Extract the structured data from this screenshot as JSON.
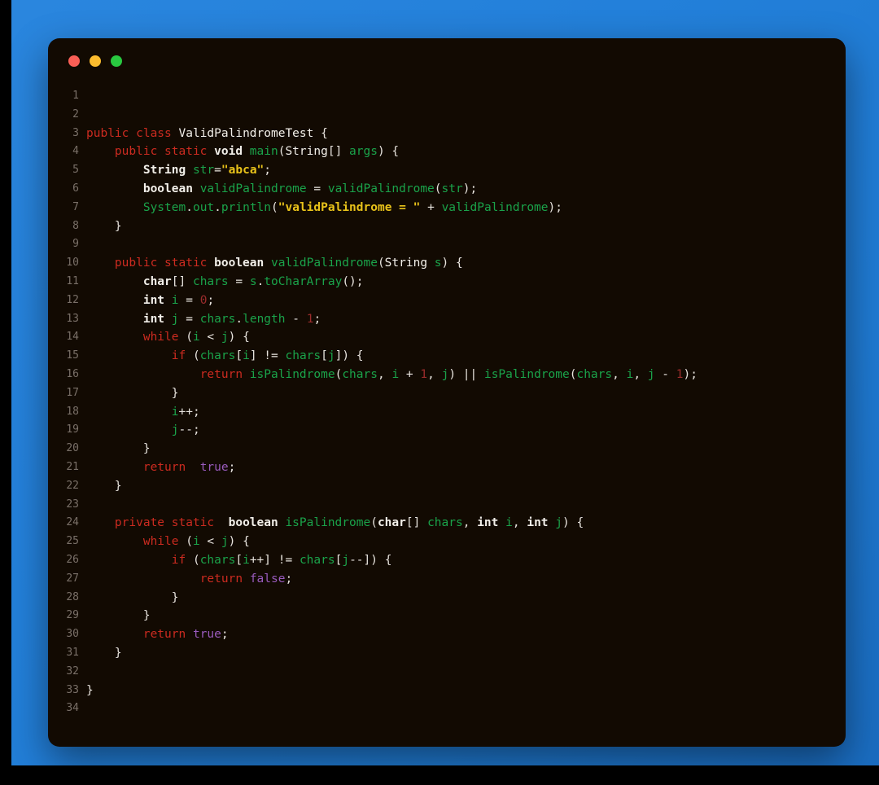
{
  "window": {
    "background_color": "#2380da",
    "card_background": "#120a02",
    "traffic_lights": [
      {
        "name": "close",
        "color": "#fa5f56"
      },
      {
        "name": "minimize",
        "color": "#fcbc2e"
      },
      {
        "name": "maximize",
        "color": "#29c940"
      }
    ]
  },
  "editor": {
    "language": "java",
    "file_class": "ValidPalindromeTest",
    "total_lines": 34,
    "theme": {
      "keyword": "#cc2b20",
      "type": "#f2efe9",
      "identifier": "#1aa34a",
      "string": "#e8c21a",
      "number": "#9b2c2c",
      "literal": "#9a5bbd",
      "punctuation": "#e8e4de",
      "line_number": "#7a7068"
    },
    "lines": [
      {
        "n": "1",
        "tokens": []
      },
      {
        "n": "2",
        "tokens": []
      },
      {
        "n": "3",
        "tokens": [
          {
            "t": "public ",
            "c": "kw"
          },
          {
            "t": "class ",
            "c": "kw"
          },
          {
            "t": "ValidPalindromeTest",
            "c": "cls"
          },
          {
            "t": " {",
            "c": "pun"
          }
        ]
      },
      {
        "n": "4",
        "tokens": [
          {
            "t": "    ",
            "c": "pun"
          },
          {
            "t": "public ",
            "c": "kw"
          },
          {
            "t": "static ",
            "c": "kw"
          },
          {
            "t": "void",
            "c": "typ"
          },
          {
            "t": " ",
            "c": "pun"
          },
          {
            "t": "main",
            "c": "var"
          },
          {
            "t": "(",
            "c": "pun"
          },
          {
            "t": "String",
            "c": "cls"
          },
          {
            "t": "[] ",
            "c": "pun"
          },
          {
            "t": "args",
            "c": "var"
          },
          {
            "t": ") {",
            "c": "pun"
          }
        ]
      },
      {
        "n": "5",
        "tokens": [
          {
            "t": "        ",
            "c": "pun"
          },
          {
            "t": "String",
            "c": "typ"
          },
          {
            "t": " ",
            "c": "pun"
          },
          {
            "t": "str",
            "c": "var"
          },
          {
            "t": "=",
            "c": "pun"
          },
          {
            "t": "\"abca\"",
            "c": "str"
          },
          {
            "t": ";",
            "c": "pun"
          }
        ]
      },
      {
        "n": "6",
        "tokens": [
          {
            "t": "        ",
            "c": "pun"
          },
          {
            "t": "boolean",
            "c": "typ"
          },
          {
            "t": " ",
            "c": "pun"
          },
          {
            "t": "validPalindrome",
            "c": "var"
          },
          {
            "t": " = ",
            "c": "pun"
          },
          {
            "t": "validPalindrome",
            "c": "var"
          },
          {
            "t": "(",
            "c": "pun"
          },
          {
            "t": "str",
            "c": "var"
          },
          {
            "t": ");",
            "c": "pun"
          }
        ]
      },
      {
        "n": "7",
        "tokens": [
          {
            "t": "        ",
            "c": "pun"
          },
          {
            "t": "System",
            "c": "var"
          },
          {
            "t": ".",
            "c": "pun"
          },
          {
            "t": "out",
            "c": "var"
          },
          {
            "t": ".",
            "c": "pun"
          },
          {
            "t": "println",
            "c": "var"
          },
          {
            "t": "(",
            "c": "pun"
          },
          {
            "t": "\"validPalindrome = \"",
            "c": "str"
          },
          {
            "t": " + ",
            "c": "pun"
          },
          {
            "t": "validPalindrome",
            "c": "var"
          },
          {
            "t": ");",
            "c": "pun"
          }
        ]
      },
      {
        "n": "8",
        "tokens": [
          {
            "t": "    }",
            "c": "pun"
          }
        ]
      },
      {
        "n": "9",
        "tokens": []
      },
      {
        "n": "10",
        "tokens": [
          {
            "t": "    ",
            "c": "pun"
          },
          {
            "t": "public ",
            "c": "kw"
          },
          {
            "t": "static ",
            "c": "kw"
          },
          {
            "t": "boolean",
            "c": "typ"
          },
          {
            "t": " ",
            "c": "pun"
          },
          {
            "t": "validPalindrome",
            "c": "var"
          },
          {
            "t": "(",
            "c": "pun"
          },
          {
            "t": "String",
            "c": "cls"
          },
          {
            "t": " ",
            "c": "pun"
          },
          {
            "t": "s",
            "c": "var"
          },
          {
            "t": ") {",
            "c": "pun"
          }
        ]
      },
      {
        "n": "11",
        "tokens": [
          {
            "t": "        ",
            "c": "pun"
          },
          {
            "t": "char",
            "c": "typ"
          },
          {
            "t": "[] ",
            "c": "pun"
          },
          {
            "t": "chars",
            "c": "var"
          },
          {
            "t": " = ",
            "c": "pun"
          },
          {
            "t": "s",
            "c": "var"
          },
          {
            "t": ".",
            "c": "pun"
          },
          {
            "t": "toCharArray",
            "c": "var"
          },
          {
            "t": "();",
            "c": "pun"
          }
        ]
      },
      {
        "n": "12",
        "tokens": [
          {
            "t": "        ",
            "c": "pun"
          },
          {
            "t": "int",
            "c": "typ"
          },
          {
            "t": " ",
            "c": "pun"
          },
          {
            "t": "i",
            "c": "var"
          },
          {
            "t": " = ",
            "c": "pun"
          },
          {
            "t": "0",
            "c": "num"
          },
          {
            "t": ";",
            "c": "pun"
          }
        ]
      },
      {
        "n": "13",
        "tokens": [
          {
            "t": "        ",
            "c": "pun"
          },
          {
            "t": "int",
            "c": "typ"
          },
          {
            "t": " ",
            "c": "pun"
          },
          {
            "t": "j",
            "c": "var"
          },
          {
            "t": " = ",
            "c": "pun"
          },
          {
            "t": "chars",
            "c": "var"
          },
          {
            "t": ".",
            "c": "pun"
          },
          {
            "t": "length",
            "c": "var"
          },
          {
            "t": " - ",
            "c": "pun"
          },
          {
            "t": "1",
            "c": "num"
          },
          {
            "t": ";",
            "c": "pun"
          }
        ]
      },
      {
        "n": "14",
        "tokens": [
          {
            "t": "        ",
            "c": "pun"
          },
          {
            "t": "while",
            "c": "kw"
          },
          {
            "t": " (",
            "c": "pun"
          },
          {
            "t": "i",
            "c": "var"
          },
          {
            "t": " < ",
            "c": "pun"
          },
          {
            "t": "j",
            "c": "var"
          },
          {
            "t": ") {",
            "c": "pun"
          }
        ]
      },
      {
        "n": "15",
        "tokens": [
          {
            "t": "            ",
            "c": "pun"
          },
          {
            "t": "if",
            "c": "kw"
          },
          {
            "t": " (",
            "c": "pun"
          },
          {
            "t": "chars",
            "c": "var"
          },
          {
            "t": "[",
            "c": "pun"
          },
          {
            "t": "i",
            "c": "var"
          },
          {
            "t": "] != ",
            "c": "pun"
          },
          {
            "t": "chars",
            "c": "var"
          },
          {
            "t": "[",
            "c": "pun"
          },
          {
            "t": "j",
            "c": "var"
          },
          {
            "t": "]) {",
            "c": "pun"
          }
        ]
      },
      {
        "n": "16",
        "tokens": [
          {
            "t": "                ",
            "c": "pun"
          },
          {
            "t": "return",
            "c": "kw"
          },
          {
            "t": " ",
            "c": "pun"
          },
          {
            "t": "isPalindrome",
            "c": "var"
          },
          {
            "t": "(",
            "c": "pun"
          },
          {
            "t": "chars",
            "c": "var"
          },
          {
            "t": ", ",
            "c": "pun"
          },
          {
            "t": "i",
            "c": "var"
          },
          {
            "t": " + ",
            "c": "pun"
          },
          {
            "t": "1",
            "c": "num"
          },
          {
            "t": ", ",
            "c": "pun"
          },
          {
            "t": "j",
            "c": "var"
          },
          {
            "t": ") || ",
            "c": "pun"
          },
          {
            "t": "isPalindrome",
            "c": "var"
          },
          {
            "t": "(",
            "c": "pun"
          },
          {
            "t": "chars",
            "c": "var"
          },
          {
            "t": ", ",
            "c": "pun"
          },
          {
            "t": "i",
            "c": "var"
          },
          {
            "t": ", ",
            "c": "pun"
          },
          {
            "t": "j",
            "c": "var"
          },
          {
            "t": " - ",
            "c": "pun"
          },
          {
            "t": "1",
            "c": "num"
          },
          {
            "t": ");",
            "c": "pun"
          }
        ]
      },
      {
        "n": "17",
        "tokens": [
          {
            "t": "            }",
            "c": "pun"
          }
        ]
      },
      {
        "n": "18",
        "tokens": [
          {
            "t": "            ",
            "c": "pun"
          },
          {
            "t": "i",
            "c": "var"
          },
          {
            "t": "++;",
            "c": "pun"
          }
        ]
      },
      {
        "n": "19",
        "tokens": [
          {
            "t": "            ",
            "c": "pun"
          },
          {
            "t": "j",
            "c": "var"
          },
          {
            "t": "--;",
            "c": "pun"
          }
        ]
      },
      {
        "n": "20",
        "tokens": [
          {
            "t": "        }",
            "c": "pun"
          }
        ]
      },
      {
        "n": "21",
        "tokens": [
          {
            "t": "        ",
            "c": "pun"
          },
          {
            "t": "return",
            "c": "kw"
          },
          {
            "t": "  ",
            "c": "pun"
          },
          {
            "t": "true",
            "c": "lit"
          },
          {
            "t": ";",
            "c": "pun"
          }
        ]
      },
      {
        "n": "22",
        "tokens": [
          {
            "t": "    }",
            "c": "pun"
          }
        ]
      },
      {
        "n": "23",
        "tokens": []
      },
      {
        "n": "24",
        "tokens": [
          {
            "t": "    ",
            "c": "pun"
          },
          {
            "t": "private ",
            "c": "kw"
          },
          {
            "t": "static ",
            "c": "kw"
          },
          {
            "t": " ",
            "c": "pun"
          },
          {
            "t": "boolean",
            "c": "typ"
          },
          {
            "t": " ",
            "c": "pun"
          },
          {
            "t": "isPalindrome",
            "c": "var"
          },
          {
            "t": "(",
            "c": "pun"
          },
          {
            "t": "char",
            "c": "typ"
          },
          {
            "t": "[] ",
            "c": "pun"
          },
          {
            "t": "chars",
            "c": "var"
          },
          {
            "t": ", ",
            "c": "pun"
          },
          {
            "t": "int",
            "c": "typ"
          },
          {
            "t": " ",
            "c": "pun"
          },
          {
            "t": "i",
            "c": "var"
          },
          {
            "t": ", ",
            "c": "pun"
          },
          {
            "t": "int",
            "c": "typ"
          },
          {
            "t": " ",
            "c": "pun"
          },
          {
            "t": "j",
            "c": "var"
          },
          {
            "t": ") {",
            "c": "pun"
          }
        ]
      },
      {
        "n": "25",
        "tokens": [
          {
            "t": "        ",
            "c": "pun"
          },
          {
            "t": "while",
            "c": "kw"
          },
          {
            "t": " (",
            "c": "pun"
          },
          {
            "t": "i",
            "c": "var"
          },
          {
            "t": " < ",
            "c": "pun"
          },
          {
            "t": "j",
            "c": "var"
          },
          {
            "t": ") {",
            "c": "pun"
          }
        ]
      },
      {
        "n": "26",
        "tokens": [
          {
            "t": "            ",
            "c": "pun"
          },
          {
            "t": "if",
            "c": "kw"
          },
          {
            "t": " (",
            "c": "pun"
          },
          {
            "t": "chars",
            "c": "var"
          },
          {
            "t": "[",
            "c": "pun"
          },
          {
            "t": "i",
            "c": "var"
          },
          {
            "t": "++] != ",
            "c": "pun"
          },
          {
            "t": "chars",
            "c": "var"
          },
          {
            "t": "[",
            "c": "pun"
          },
          {
            "t": "j",
            "c": "var"
          },
          {
            "t": "--]) {",
            "c": "pun"
          }
        ]
      },
      {
        "n": "27",
        "tokens": [
          {
            "t": "                ",
            "c": "pun"
          },
          {
            "t": "return",
            "c": "kw"
          },
          {
            "t": " ",
            "c": "pun"
          },
          {
            "t": "false",
            "c": "lit"
          },
          {
            "t": ";",
            "c": "pun"
          }
        ]
      },
      {
        "n": "28",
        "tokens": [
          {
            "t": "            }",
            "c": "pun"
          }
        ]
      },
      {
        "n": "29",
        "tokens": [
          {
            "t": "        }",
            "c": "pun"
          }
        ]
      },
      {
        "n": "30",
        "tokens": [
          {
            "t": "        ",
            "c": "pun"
          },
          {
            "t": "return",
            "c": "kw"
          },
          {
            "t": " ",
            "c": "pun"
          },
          {
            "t": "true",
            "c": "lit"
          },
          {
            "t": ";",
            "c": "pun"
          }
        ]
      },
      {
        "n": "31",
        "tokens": [
          {
            "t": "    }",
            "c": "pun"
          }
        ]
      },
      {
        "n": "32",
        "tokens": []
      },
      {
        "n": "33",
        "tokens": [
          {
            "t": "}",
            "c": "pun"
          }
        ]
      },
      {
        "n": "34",
        "tokens": []
      }
    ]
  }
}
